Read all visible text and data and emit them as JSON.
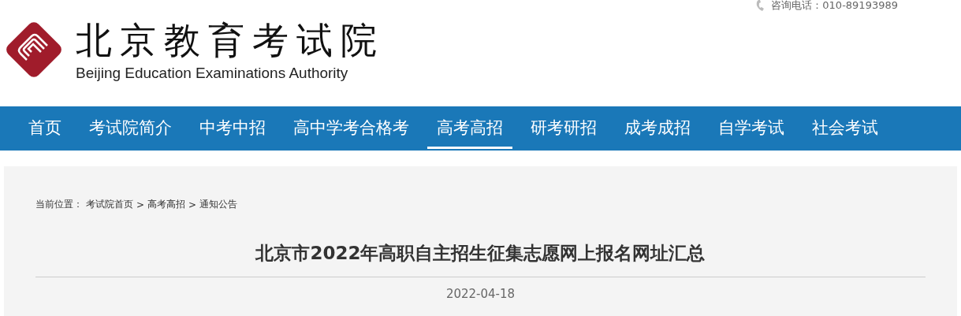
{
  "header": {
    "logo_title": "北京教育考试院",
    "logo_subtitle": "Beijing Education Examinations Authority",
    "phone": "咨询电话：010-89193989"
  },
  "nav": [
    {
      "label": "首页",
      "selected": false
    },
    {
      "label": "考试院简介",
      "selected": false
    },
    {
      "label": "中考中招",
      "selected": false
    },
    {
      "label": "高中学考合格考",
      "selected": false
    },
    {
      "label": "高考高招",
      "selected": true
    },
    {
      "label": "研考研招",
      "selected": false
    },
    {
      "label": "成考成招",
      "selected": false
    },
    {
      "label": "自学考试",
      "selected": false
    },
    {
      "label": "社会考试",
      "selected": false
    }
  ],
  "breadcrumb": {
    "label": "当前位置：",
    "links": [
      "考试院首页",
      "高考高招",
      "通知公告"
    ],
    "separator": ">"
  },
  "article": {
    "title": "北京市2022年高职自主招生征集志愿网上报名网址汇总",
    "date": "2022-04-18"
  }
}
